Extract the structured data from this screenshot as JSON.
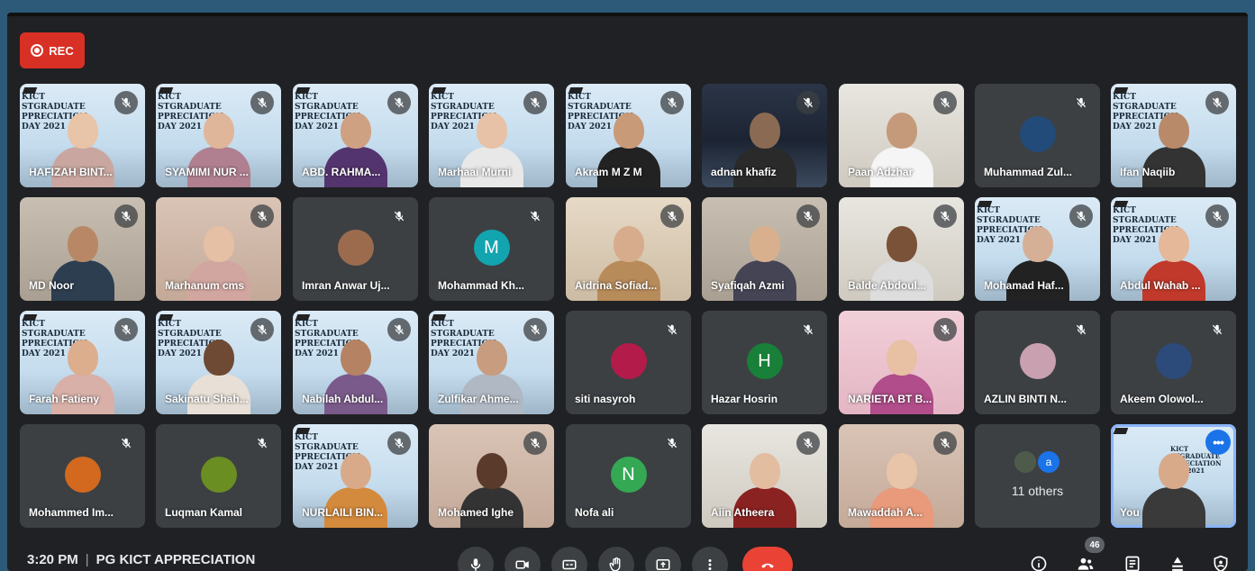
{
  "meeting": {
    "recording_label": "REC",
    "time": "3:20 PM",
    "separator": "|",
    "title": "PG KICT APPRECIATION",
    "participant_count": "46"
  },
  "poster_text": {
    "line1": "KICT",
    "line2": "STGRADUATE",
    "line3": "PPRECIATION",
    "line4": "DAY 2021"
  },
  "participants": [
    {
      "name": "HAFIZAH BINT..."
    },
    {
      "name": "SYAMIMI NUR ..."
    },
    {
      "name": "ABD. RAHMA..."
    },
    {
      "name": "Marhaai Murni"
    },
    {
      "name": "Akram M Z M"
    },
    {
      "name": "adnan khafiz"
    },
    {
      "name": "Paan Adzhar"
    },
    {
      "name": "Muhammad Zul..."
    },
    {
      "name": "Ifan Naqiib"
    },
    {
      "name": "MD Noor"
    },
    {
      "name": "Marhanum cms"
    },
    {
      "name": "Imran Anwar Uj..."
    },
    {
      "name": "Mohammad Kh...",
      "initial": "M",
      "color": "#12a4af"
    },
    {
      "name": "Aidrina Sofiad..."
    },
    {
      "name": "Syafiqah Azmi"
    },
    {
      "name": "Balde Abdoul..."
    },
    {
      "name": "Mohamad Haf..."
    },
    {
      "name": "Abdul Wahab ..."
    },
    {
      "name": "Farah Fatieny"
    },
    {
      "name": "Sakinatu Shah..."
    },
    {
      "name": "Nabilah Abdul..."
    },
    {
      "name": "Zulfikar Ahme..."
    },
    {
      "name": "siti nasyroh"
    },
    {
      "name": "Hazar Hosrin",
      "initial": "H",
      "color": "#188038"
    },
    {
      "name": "NARIETA BT B..."
    },
    {
      "name": "AZLIN BINTI N..."
    },
    {
      "name": "Akeem Olowol..."
    },
    {
      "name": "Mohammed Im..."
    },
    {
      "name": "Luqman Kamal"
    },
    {
      "name": "NURLAILI BIN..."
    },
    {
      "name": "Mohamed Ighe"
    },
    {
      "name": "Nofa ali",
      "initial": "N",
      "color": "#34a853"
    },
    {
      "name": "Aiin Atheera"
    },
    {
      "name": "Mawaddah A..."
    },
    {
      "name": "11 others",
      "avatar_letter": "a"
    },
    {
      "name": "You"
    }
  ],
  "controls": {
    "more_options_glyph": "•••"
  },
  "colors": {
    "accent_blue": "#1a73e8",
    "end_call_red": "#ea4335",
    "rec_red": "#d93025"
  }
}
